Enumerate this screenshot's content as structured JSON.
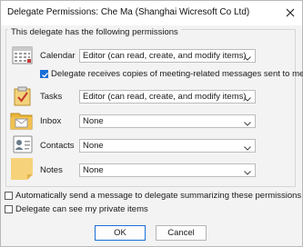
{
  "window": {
    "title": "Delegate Permissions: Che Ma (Shanghai Wicresoft Co Ltd)"
  },
  "permissions": {
    "legend": "This delegate has the following permissions",
    "rows": [
      {
        "label": "Calendar",
        "value": "Editor (can read, create, and modify items)",
        "icon": "calendar-icon"
      },
      {
        "label": "Tasks",
        "value": "Editor (can read, create, and modify items)",
        "icon": "tasks-icon"
      },
      {
        "label": "Inbox",
        "value": "None",
        "icon": "inbox-icon"
      },
      {
        "label": "Contacts",
        "value": "None",
        "icon": "contacts-icon"
      },
      {
        "label": "Notes",
        "value": "None",
        "icon": "notes-icon"
      }
    ],
    "meeting_copies": {
      "label": "Delegate receives copies of meeting-related messages sent to me",
      "checked": true
    }
  },
  "options": {
    "auto_send": {
      "label": "Automatically send a message to delegate summarizing these permissions",
      "checked": false
    },
    "private_items": {
      "label": "Delegate can see my private items",
      "checked": false
    }
  },
  "buttons": {
    "ok": "OK",
    "cancel": "Cancel"
  },
  "colors": {
    "accent": "#1a6ed8",
    "folder": "#f2c14e",
    "notes": "#f6d37a"
  }
}
